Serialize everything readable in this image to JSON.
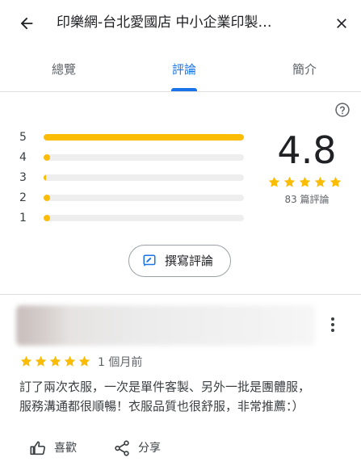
{
  "header": {
    "title": "印樂網-台北愛國店 中小企業印製…"
  },
  "tabs": [
    {
      "label": "總覽",
      "active": false
    },
    {
      "label": "評論",
      "active": true
    },
    {
      "label": "簡介",
      "active": false
    }
  ],
  "rating_summary": {
    "score": "4.8",
    "review_count_label": "83 篇評論",
    "star_count": 5,
    "distribution": [
      {
        "stars": "5",
        "fraction": 1.0
      },
      {
        "stars": "4",
        "fraction": 0.02
      },
      {
        "stars": "3",
        "fraction": 0.0
      },
      {
        "stars": "2",
        "fraction": 0.03
      },
      {
        "stars": "1",
        "fraction": 0.03
      }
    ]
  },
  "write_review": {
    "label": "撰寫評論"
  },
  "review": {
    "rating": 5,
    "date": "1 個月前",
    "text_line1": "訂了兩次衣服，一次是單件客製、另外一批是團體服，",
    "text_line2": "服務溝通都很順暢！衣服品質也很舒服，非常推薦：）",
    "like_label": "喜歡",
    "share_label": "分享"
  },
  "colors": {
    "accent": "#1a73e8",
    "star": "#fbbc04",
    "track": "#eeeeee",
    "text_primary": "#202124",
    "text_secondary": "#5f6368"
  }
}
